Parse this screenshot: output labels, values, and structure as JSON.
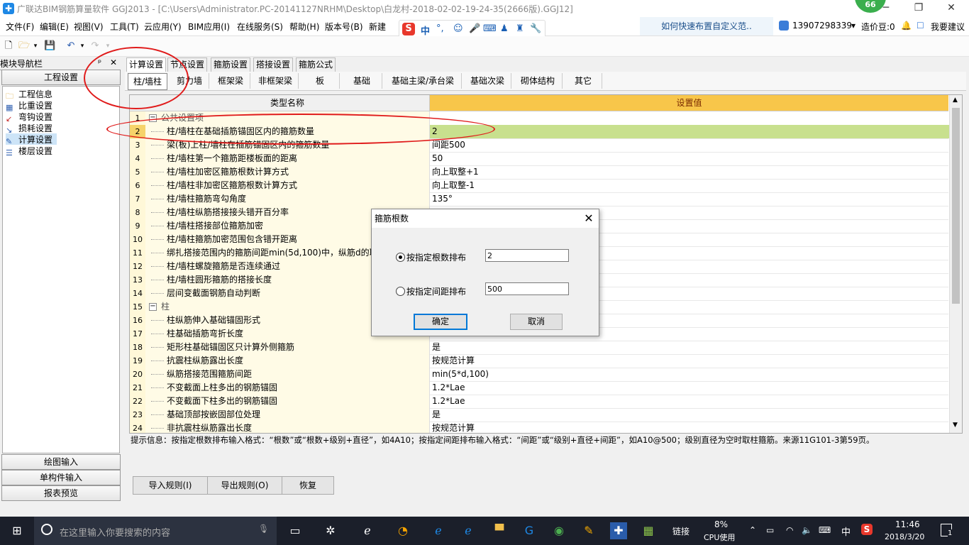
{
  "window": {
    "title": "广联达BIM钢筋算量软件 GGJ2013 - [C:\\Users\\Administrator.PC-20141127NRHM\\Desktop\\白龙村-2018-02-02-19-24-35(2666版).GGJ12]",
    "badge": "66",
    "minimize": "─",
    "maximize": "❐",
    "close": "✕"
  },
  "menu": {
    "items": [
      "文件(F)",
      "编辑(E)",
      "视图(V)",
      "工具(T)",
      "云应用(Y)",
      "BIM应用(I)",
      "在线服务(S)",
      "帮助(H)",
      "版本号(B)",
      "新建"
    ],
    "hint_link": "如何快速布置自定义范..",
    "phone": "13907298339",
    "cost_bean": "造价豆:0",
    "suggest": "我要建议",
    "ime": {
      "logo": "S",
      "lang": "中",
      "punct": "°,"
    }
  },
  "left_panel": {
    "header": "模块导航栏",
    "pin": "ᵖ",
    "close": "✕",
    "section_top": "工程设置",
    "tree": [
      {
        "label": "工程信息",
        "icon": "project-info-icon"
      },
      {
        "label": "比重设置",
        "icon": "weight-icon"
      },
      {
        "label": "弯钩设置",
        "icon": "hook-icon"
      },
      {
        "label": "损耗设置",
        "icon": "loss-icon"
      },
      {
        "label": "计算设置",
        "icon": "calc-settings-icon"
      },
      {
        "label": "楼层设置",
        "icon": "floor-icon"
      }
    ],
    "sections_bottom": [
      "绘图输入",
      "单构件输入",
      "报表预览"
    ]
  },
  "tabs_main": [
    "计算设置",
    "节点设置",
    "箍筋设置",
    "搭接设置",
    "箍筋公式"
  ],
  "tabs_sub": [
    "柱/墙柱",
    "剪力墙",
    "框架梁",
    "非框架梁",
    "板",
    "基础",
    "基础主梁/承台梁",
    "基础次梁",
    "砌体结构",
    "其它"
  ],
  "grid": {
    "col_name": "类型名称",
    "col_value": "设置值",
    "rows": [
      {
        "num": "1",
        "name": "公共设置项",
        "value": "",
        "group": true
      },
      {
        "num": "2",
        "name": "柱/墙柱在基础插筋锚固区内的箍筋数量",
        "value": "2",
        "selected": true
      },
      {
        "num": "3",
        "name": "梁(板)上柱/墙柱在插筋锚固区内的箍筋数量",
        "value": "间距500"
      },
      {
        "num": "4",
        "name": "柱/墙柱第一个箍筋距楼板面的距离",
        "value": "50"
      },
      {
        "num": "5",
        "name": "柱/墙柱加密区箍筋根数计算方式",
        "value": "向上取整+1"
      },
      {
        "num": "6",
        "name": "柱/墙柱非加密区箍筋根数计算方式",
        "value": "向上取整-1"
      },
      {
        "num": "7",
        "name": "柱/墙柱箍筋弯勾角度",
        "value": "135°"
      },
      {
        "num": "8",
        "name": "柱/墙柱纵筋搭接接头错开百分率",
        "value": ""
      },
      {
        "num": "9",
        "name": "柱/墙柱搭接部位箍筋加密",
        "value": ""
      },
      {
        "num": "10",
        "name": "柱/墙柱箍筋加密范围包含错开距离",
        "value": ""
      },
      {
        "num": "11",
        "name": "绑扎搭接范围内的箍筋间距min(5d,100)中，纵筋d的取",
        "value": ""
      },
      {
        "num": "12",
        "name": "柱/墙柱螺旋箍筋是否连续通过",
        "value": ""
      },
      {
        "num": "13",
        "name": "柱/墙柱圆形箍筋的搭接长度",
        "value": ""
      },
      {
        "num": "14",
        "name": "层间变截面钢筋自动判断",
        "value": ""
      },
      {
        "num": "15",
        "name": "柱",
        "value": "",
        "group": true
      },
      {
        "num": "16",
        "name": "柱纵筋伸入基础锚固形式",
        "value": ""
      },
      {
        "num": "17",
        "name": "柱基础插筋弯折长度",
        "value": ""
      },
      {
        "num": "18",
        "name": "矩形柱基础锚固区只计算外侧箍筋",
        "value": "是"
      },
      {
        "num": "19",
        "name": "抗震柱纵筋露出长度",
        "value": "按规范计算"
      },
      {
        "num": "20",
        "name": "纵筋搭接范围箍筋间距",
        "value": "min(5*d,100)"
      },
      {
        "num": "21",
        "name": "不变截面上柱多出的钢筋锚固",
        "value": "1.2*Lae"
      },
      {
        "num": "22",
        "name": "不变截面下柱多出的钢筋锚固",
        "value": "1.2*Lae"
      },
      {
        "num": "23",
        "name": "基础顶部按嵌固部位处理",
        "value": "是"
      },
      {
        "num": "24",
        "name": "非抗震柱纵筋露出长度",
        "value": "按规范计算"
      }
    ]
  },
  "hint": "提示信息：按指定根数排布输入格式：“根数”或“根数+级别+直径”，如4A10；按指定间距排布输入格式：“间距”或“级别+直径+间距”，如A10@500；级别直径为空时取柱箍筋。来源11G101-3第59页。",
  "bottom_buttons": [
    "导入规则(I)",
    "导出规则(O)",
    "恢复"
  ],
  "dialog": {
    "title": "箍筋根数",
    "option1_label": "按指定根数排布",
    "option1_value": "2",
    "option1_selected": true,
    "option2_label": "按指定间距排布",
    "option2_value": "500",
    "ok": "确定",
    "cancel": "取消"
  },
  "taskbar": {
    "search_placeholder": "在这里输入你要搜索的内容",
    "link": "链接",
    "cpu_percent": "8%",
    "cpu_label": "CPU使用",
    "ime_lang": "中",
    "time": "11:46",
    "date": "2018/3/20",
    "notifications": "1"
  }
}
